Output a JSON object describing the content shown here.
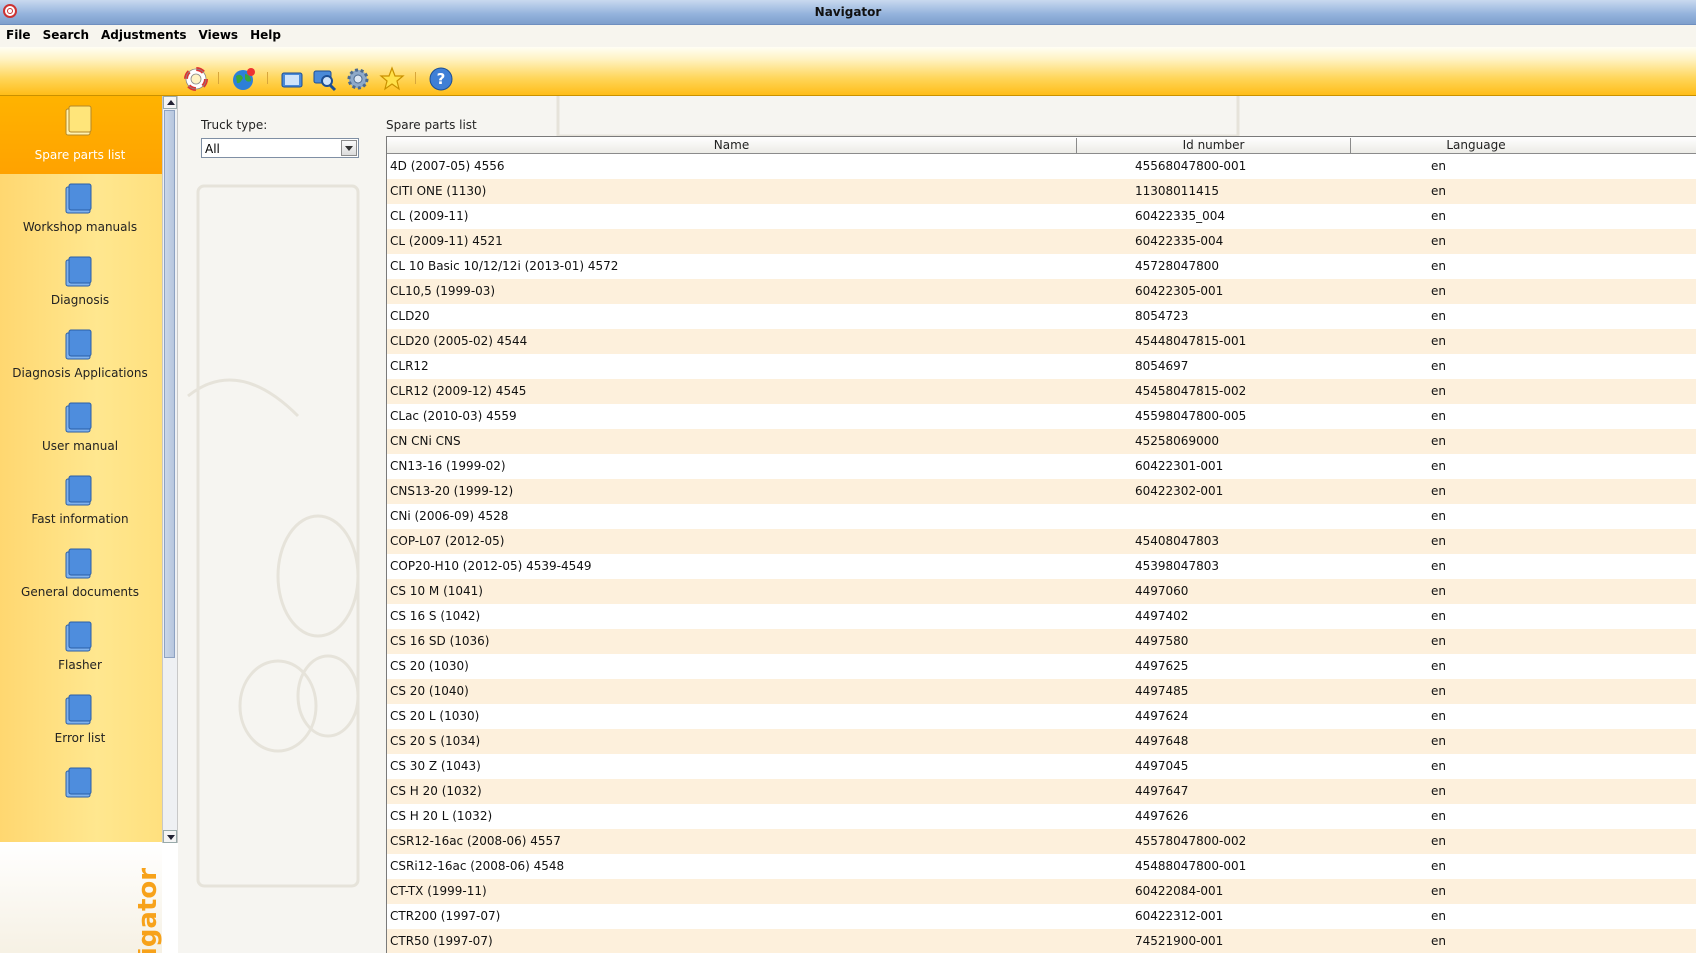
{
  "window": {
    "title": "Navigator"
  },
  "menu": [
    "File",
    "Search",
    "Adjustments",
    "Views",
    "Help"
  ],
  "toolbar": {
    "icons": [
      "lifebuoy-icon",
      "globe-icon",
      "book-search-icon",
      "search-icon",
      "gear-icon",
      "star-icon",
      "help-icon"
    ]
  },
  "sidebar": {
    "items": [
      {
        "label": "Spare parts list",
        "active": true
      },
      {
        "label": "Workshop manuals"
      },
      {
        "label": "Diagnosis"
      },
      {
        "label": "Diagnosis Applications"
      },
      {
        "label": "User manual"
      },
      {
        "label": "Fast information"
      },
      {
        "label": "General documents"
      },
      {
        "label": "Flasher"
      },
      {
        "label": "Error list"
      },
      {
        "label": ""
      }
    ],
    "brand_text": "igator"
  },
  "filter": {
    "label": "Truck type:",
    "value": "All"
  },
  "list": {
    "label": "Spare parts list",
    "columns": [
      "Name",
      "Id number",
      "Language"
    ],
    "rows": [
      [
        "4D (2007-05) 4556",
        "45568047800-001",
        "en"
      ],
      [
        "CITI ONE (1130)",
        "11308011415",
        "en"
      ],
      [
        "CL (2009-11)",
        "60422335_004",
        "en"
      ],
      [
        "CL (2009-11) 4521",
        "60422335-004",
        "en"
      ],
      [
        "CL 10 Basic 10/12/12i (2013-01) 4572",
        "45728047800",
        "en"
      ],
      [
        "CL10,5 (1999-03)",
        "60422305-001",
        "en"
      ],
      [
        "CLD20",
        "8054723",
        "en"
      ],
      [
        "CLD20 (2005-02) 4544",
        "45448047815-001",
        "en"
      ],
      [
        "CLR12",
        "8054697",
        "en"
      ],
      [
        "CLR12 (2009-12) 4545",
        "45458047815-002",
        "en"
      ],
      [
        "CLac (2010-03) 4559",
        "45598047800-005",
        "en"
      ],
      [
        "CN CNi CNS",
        "45258069000",
        "en"
      ],
      [
        "CN13-16 (1999-02)",
        "60422301-001",
        "en"
      ],
      [
        "CNS13-20 (1999-12)",
        "60422302-001",
        "en"
      ],
      [
        "CNi (2006-09) 4528",
        "",
        "en"
      ],
      [
        "COP-L07 (2012-05)",
        "45408047803",
        "en"
      ],
      [
        "COP20-H10 (2012-05) 4539-4549",
        "45398047803",
        "en"
      ],
      [
        "CS 10 M (1041)",
        "4497060",
        "en"
      ],
      [
        "CS 16 S (1042)",
        "4497402",
        "en"
      ],
      [
        "CS 16 SD (1036)",
        "4497580",
        "en"
      ],
      [
        "CS 20 (1030)",
        "4497625",
        "en"
      ],
      [
        "CS 20 (1040)",
        "4497485",
        "en"
      ],
      [
        "CS 20 L (1030)",
        "4497624",
        "en"
      ],
      [
        "CS 20 S (1034)",
        "4497648",
        "en"
      ],
      [
        "CS 30 Z (1043)",
        "4497045",
        "en"
      ],
      [
        "CS H 20 (1032)",
        "4497647",
        "en"
      ],
      [
        "CS H 20 L (1032)",
        "4497626",
        "en"
      ],
      [
        "CSR12-16ac (2008-06) 4557",
        "45578047800-002",
        "en"
      ],
      [
        "CSRi12-16ac (2008-06) 4548",
        "45488047800-001",
        "en"
      ],
      [
        "CT-TX (1999-11)",
        "60422084-001",
        "en"
      ],
      [
        "CTR200 (1997-07)",
        "60422312-001",
        "en"
      ],
      [
        "CTR50 (1997-07)",
        "74521900-001",
        "en"
      ]
    ]
  },
  "colors": {
    "accent": "#ffb300",
    "row_alt": "#fdf0dc",
    "title_bar": "#93b2dc"
  }
}
